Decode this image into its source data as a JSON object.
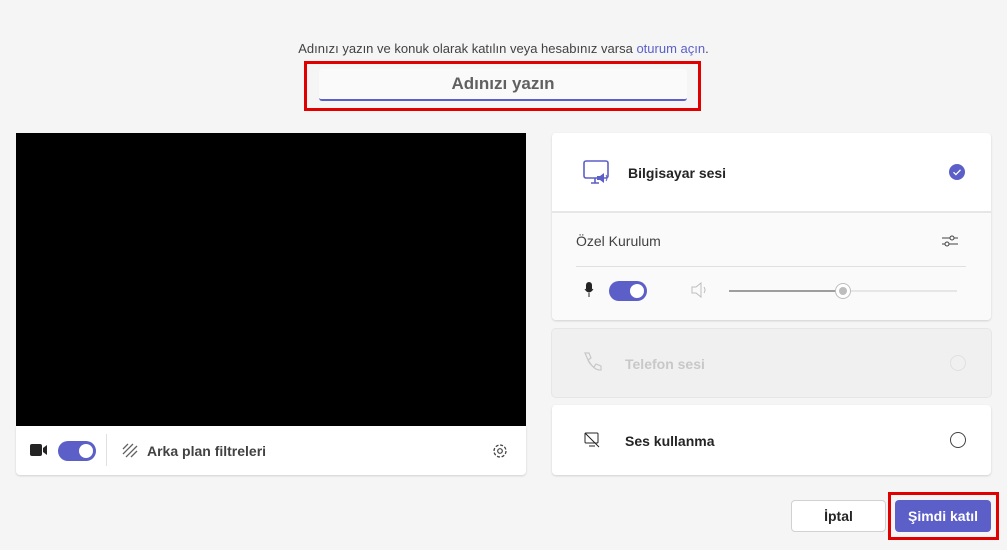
{
  "intro": {
    "text": "Adınızı yazın ve konuk olarak katılın veya hesabınız varsa ",
    "link": "oturum açın",
    "end": "."
  },
  "name_input": {
    "placeholder": "Adınızı yazın",
    "value": ""
  },
  "video": {
    "camera_on": true,
    "background_filters_label": "Arka plan filtreleri"
  },
  "audio": {
    "computer_audio": {
      "label": "Bilgisayar sesi",
      "selected": true
    },
    "custom_setup": {
      "label": "Özel Kurulum",
      "mic_on": true,
      "speaker_volume_percent": 50
    },
    "phone_audio": {
      "label": "Telefon sesi",
      "disabled": true
    },
    "no_audio": {
      "label": "Ses kullanma",
      "selected": false
    }
  },
  "buttons": {
    "cancel": "İptal",
    "join": "Şimdi katıl"
  },
  "colors": {
    "accent": "#5b5fc7",
    "annotation": "#e00000"
  }
}
